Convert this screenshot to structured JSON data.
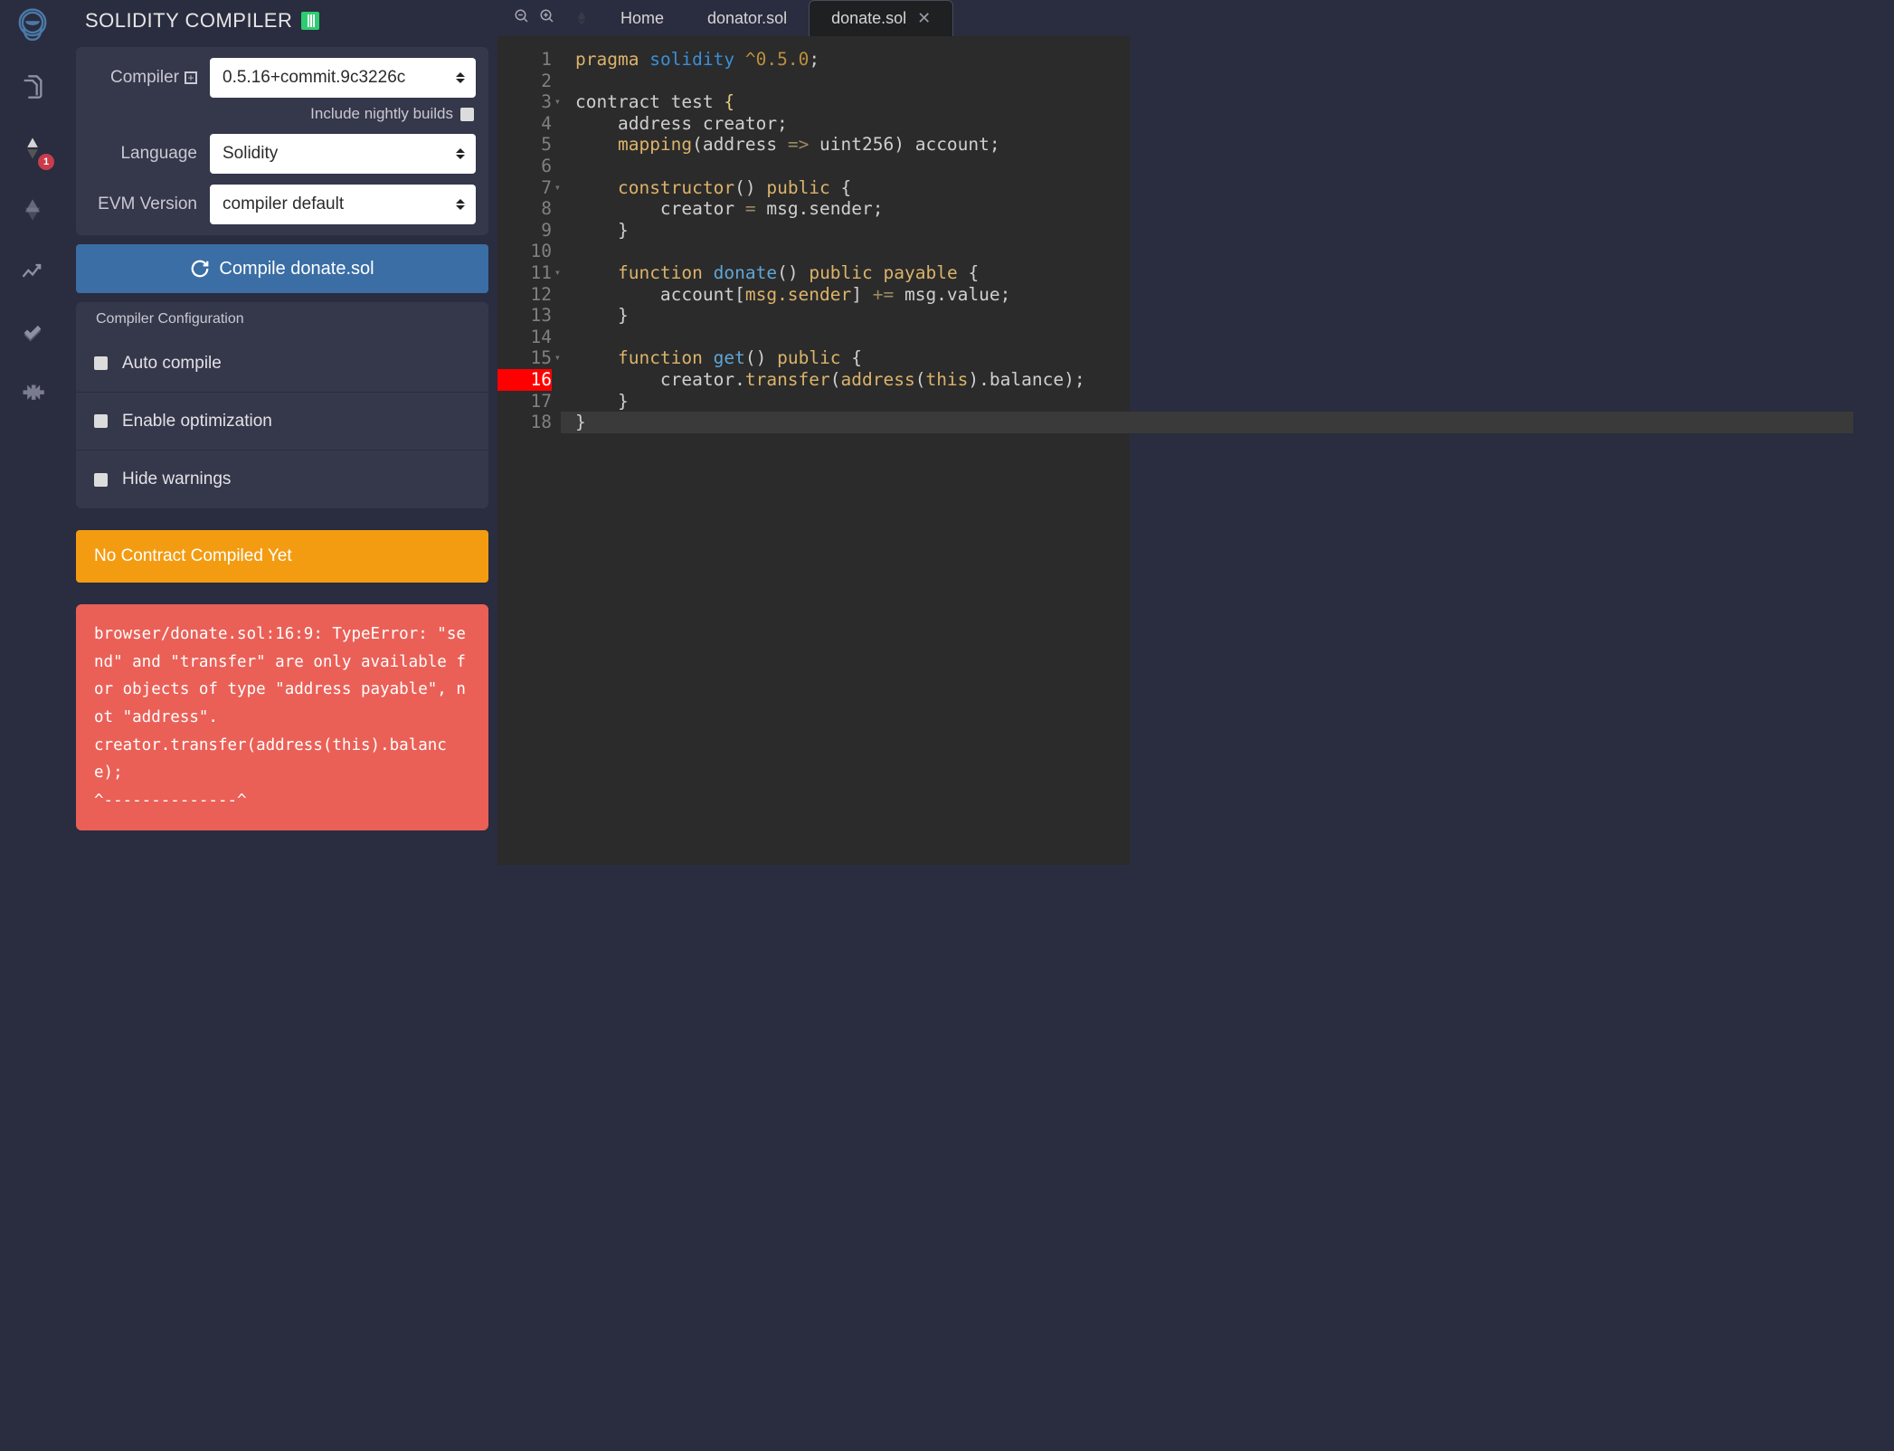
{
  "iconbar": {
    "badge": "1"
  },
  "panel": {
    "title": "SOLIDITY COMPILER",
    "compilerLabel": "Compiler",
    "compilerValue": "0.5.16+commit.9c3226c",
    "nightlyLabel": "Include nightly builds",
    "languageLabel": "Language",
    "languageValue": "Solidity",
    "evmLabel": "EVM Version",
    "evmValue": "compiler default",
    "compileBtn": "Compile donate.sol",
    "configTitle": "Compiler Configuration",
    "optAuto": "Auto compile",
    "optOptim": "Enable optimization",
    "optHide": "Hide warnings",
    "contractStatus": "No Contract Compiled Yet",
    "error": "browser/donate.sol:16:9: TypeError: \"send\" and \"transfer\" are only available for objects of type \"address payable\", not \"address\".\ncreator.transfer(address(this).balance);\n^--------------^"
  },
  "tabs": {
    "home": "Home",
    "t1": "donator.sol",
    "t2": "donate.sol"
  },
  "code": {
    "l1a": "pragma",
    "l1b": "solidity",
    "l1c": "^0.5.0",
    "l3a": "contract ",
    "l3b": "test ",
    "l4": "    address creator;",
    "l5a": "    ",
    "l5b": "mapping",
    "l5c": "(address ",
    "l5d": "=>",
    "l5e": " uint256) account;",
    "l7a": "    ",
    "l7b": "constructor",
    "l7c": "() ",
    "l7d": "public",
    "l7e": " {",
    "l8a": "        creator ",
    "l8b": "=",
    "l8c": " msg.sender;",
    "l9": "    }",
    "l11a": "    ",
    "l11b": "function",
    "l11c": " ",
    "l11d": "donate",
    "l11e": "() ",
    "l11f": "public",
    "l11g": " ",
    "l11h": "payable",
    "l11i": " {",
    "l12a": "        account[",
    "l12b": "msg.sender",
    "l12c": "] ",
    "l12d": "+=",
    "l12e": " msg.value;",
    "l13": "    }",
    "l15a": "    ",
    "l15b": "function",
    "l15c": " ",
    "l15d": "get",
    "l15e": "() ",
    "l15f": "public",
    "l15g": " {",
    "l16a": "        creator.",
    "l16b": "transfer",
    "l16c": "(",
    "l16d": "address",
    "l16e": "(",
    "l16f": "this",
    "l16g": ").balance);",
    "l17": "    }",
    "l18": "}"
  }
}
